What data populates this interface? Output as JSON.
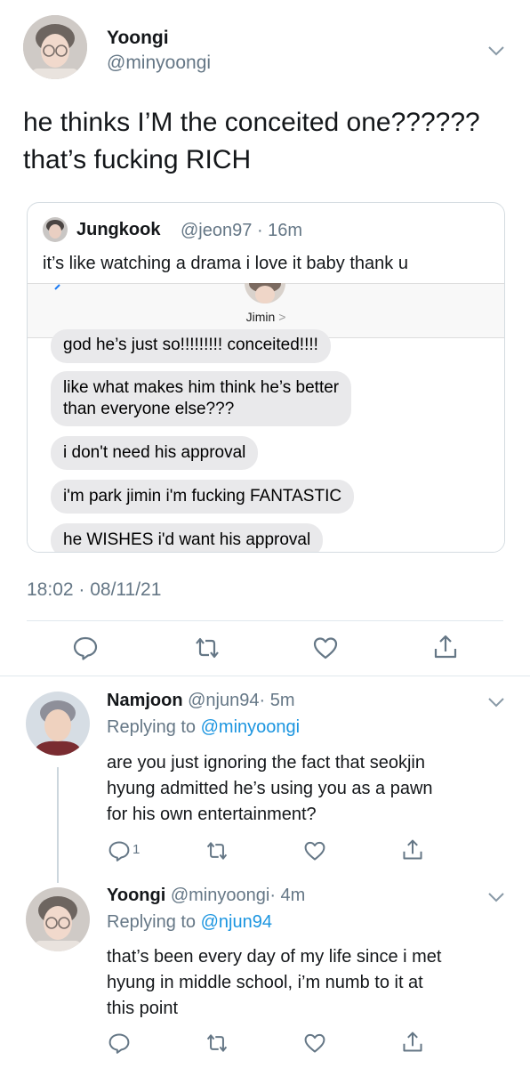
{
  "main_tweet": {
    "display_name": "Yoongi",
    "handle": "@minyoongi",
    "text_line1": "he thinks I’M the conceited one??????",
    "text_line2": "that’s fucking RICH",
    "timestamp": "18:02 · 08/11/21"
  },
  "quote_tweet": {
    "display_name": "Jungkook",
    "handle": "@jeon97",
    "time": "· 16m",
    "text": "it’s like watching a drama i love it baby thank u",
    "contact_name": "Jimin",
    "contact_chevron": ">",
    "messages": [
      "god he’s just so!!!!!!!!! conceited!!!!",
      "like what makes him think he’s better",
      "than everyone else???",
      "i don't need his approval",
      "i'm park jimin i'm fucking FANTASTIC",
      "he WISHES i'd want his approval"
    ]
  },
  "reply1": {
    "display_name": "Namjoon",
    "handle": "@njun94",
    "time": "· 5m",
    "replying_prefix": "Replying to",
    "replying_handle": "@minyoongi",
    "line1": "are you just ignoring the fact that seokjin",
    "line2": "hyung admitted he’s using you as a pawn",
    "line3": "for his own entertainment?",
    "reply_count": "1"
  },
  "reply2": {
    "display_name": "Yoongi",
    "handle": "@minyoongi",
    "time": "· 4m",
    "replying_prefix": "Replying to",
    "replying_handle": "@njun94",
    "line1": "that’s been every day of my life since i met",
    "line2": "hyung in middle school, i’m numb to it at",
    "line3": "this point"
  },
  "colors": {
    "link": "#1b95e0",
    "secondary_text": "#657786",
    "bubble_bg": "#e9e9eb",
    "divider": "#e1e8ed"
  }
}
